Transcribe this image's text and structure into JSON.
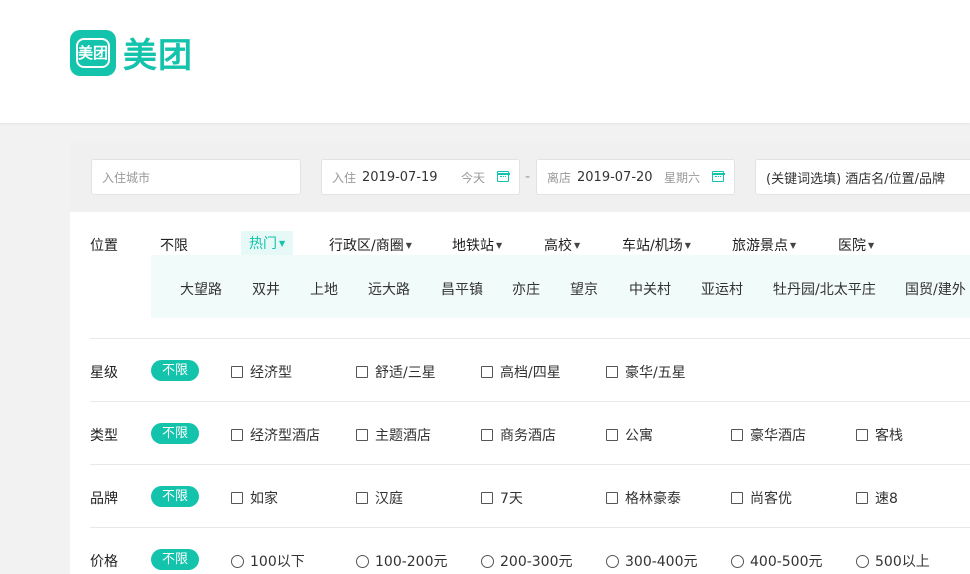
{
  "brand": {
    "logo_mark": "美团",
    "logo_text": "美团",
    "accent_color": "#13c3ab"
  },
  "search": {
    "city_placeholder": "入住城市",
    "checkin_label": "入住",
    "checkin_date": "2019-07-19",
    "checkin_day": "今天",
    "separator": "-",
    "checkout_label": "离店",
    "checkout_date": "2019-07-20",
    "checkout_day": "星期六",
    "keyword_placeholder": "(关键词选填) 酒店名/位置/品牌"
  },
  "location": {
    "label": "位置",
    "tabs": [
      "不限",
      "热门",
      "行政区/商圈",
      "地铁站",
      "高校",
      "车站/机场",
      "旅游景点",
      "医院"
    ],
    "active_tab": "热门",
    "areas": [
      "大望路",
      "双井",
      "上地",
      "远大路",
      "昌平镇",
      "亦庄",
      "望京",
      "中关村",
      "亚运村",
      "牡丹园/北太平庄",
      "国贸/建外"
    ]
  },
  "filters": {
    "star": {
      "label": "星级",
      "all": "不限",
      "options": [
        "经济型",
        "舒适/三星",
        "高档/四星",
        "豪华/五星"
      ]
    },
    "type": {
      "label": "类型",
      "all": "不限",
      "options": [
        "经济型酒店",
        "主题酒店",
        "商务酒店",
        "公寓",
        "豪华酒店",
        "客栈"
      ]
    },
    "brand": {
      "label": "品牌",
      "all": "不限",
      "options": [
        "如家",
        "汉庭",
        "7天",
        "格林豪泰",
        "尚客优",
        "速8"
      ]
    },
    "price": {
      "label": "价格",
      "all": "不限",
      "options": [
        "100以下",
        "100-200元",
        "200-300元",
        "300-400元",
        "400-500元",
        "500以上"
      ]
    }
  }
}
